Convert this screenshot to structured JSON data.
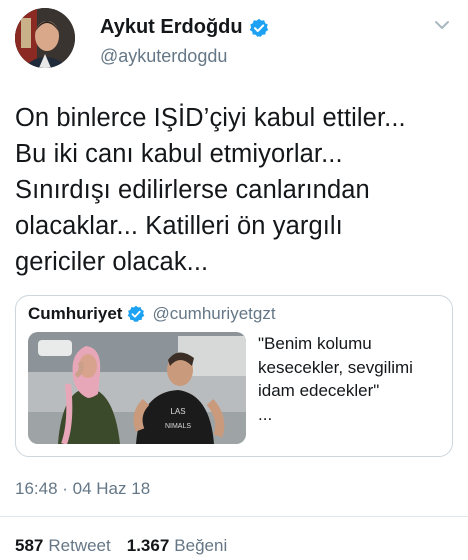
{
  "author": {
    "display_name": "Aykut Erdoğdu",
    "handle": "@aykuterdogdu",
    "avatar_icon": "avatar-photo",
    "verified_icon": "verified-badge-icon"
  },
  "tweet": {
    "text": "On binlerce IŞİD’çiyi kabul ettiler...\nBu iki canı kabul etmiyorlar...\nSınırdışı edilirlerse canlarından\nolacaklar... Katilleri ön yargılı\ngericiler olacak...",
    "timestamp": "16:48 · 04 Haz 18"
  },
  "quoted_tweet": {
    "name": "Cumhuriyet",
    "handle": "@cumhuriyetgzt",
    "text": "\"Benim kolumu\nkesecekler, sevgilimi\nidam edecekler\"\n...",
    "shirt_text": "LAS",
    "shirt_text_2": "NIMALS"
  },
  "stats": {
    "retweet_count": "587",
    "retweet_label": "Retweet",
    "like_count": "1.367",
    "like_label": "Beğeni"
  },
  "colors": {
    "primary_text": "#14171a",
    "secondary_text": "#657786",
    "verified": "#1da1f2",
    "border": "#ccd6dd"
  }
}
